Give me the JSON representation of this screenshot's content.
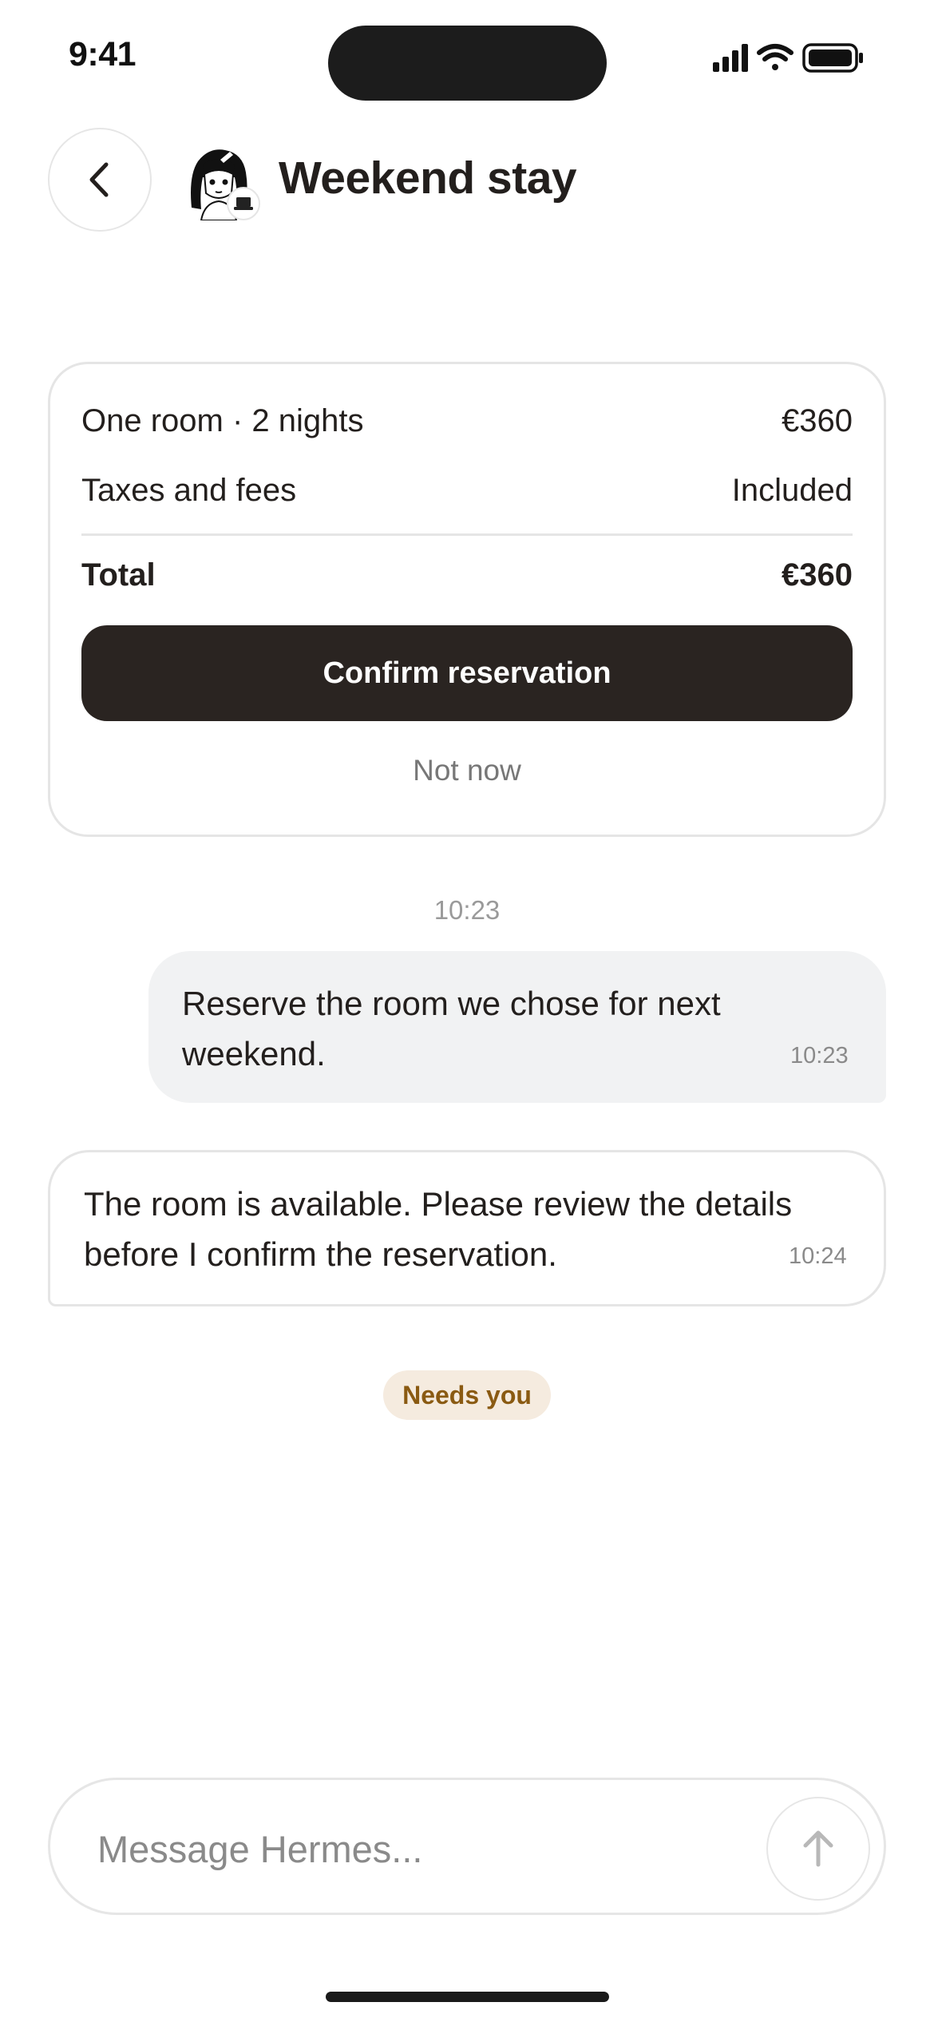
{
  "status_bar": {
    "time": "9:41",
    "icons": [
      "signal-icon",
      "wifi-icon",
      "battery-icon"
    ]
  },
  "header": {
    "title": "Weekend stay",
    "back_icon": "chevron-left-icon",
    "avatar_icon": "anime-girl-avatar",
    "avatar_badge_icon": "laptop-icon"
  },
  "summary": {
    "rows": [
      {
        "label": "One room · 2 nights",
        "value": "€360"
      },
      {
        "label": "Taxes and fees",
        "value": "Included"
      }
    ],
    "total": {
      "label": "Total",
      "value": "€360"
    },
    "confirm_label": "Confirm reservation",
    "dismiss_label": "Not now"
  },
  "chat": {
    "time_separator": "10:23",
    "messages": [
      {
        "role": "user",
        "lines": [
          "Reserve the room we chose for next",
          "weekend."
        ],
        "time": "10:23"
      },
      {
        "role": "assistant",
        "lines": [
          "The room is available. Please review the details",
          "before I confirm the reservation."
        ],
        "time": "10:24"
      }
    ],
    "status_pill": "Needs you"
  },
  "composer": {
    "placeholder": "Message Hermes...",
    "value": "",
    "send_icon": "arrow-up-icon"
  },
  "colors": {
    "primary_button": "#2a2421",
    "user_bubble": "#f1f2f3",
    "pill_bg": "#f5ebdf",
    "pill_text": "#8a5a12",
    "border": "#e5e5e5"
  }
}
